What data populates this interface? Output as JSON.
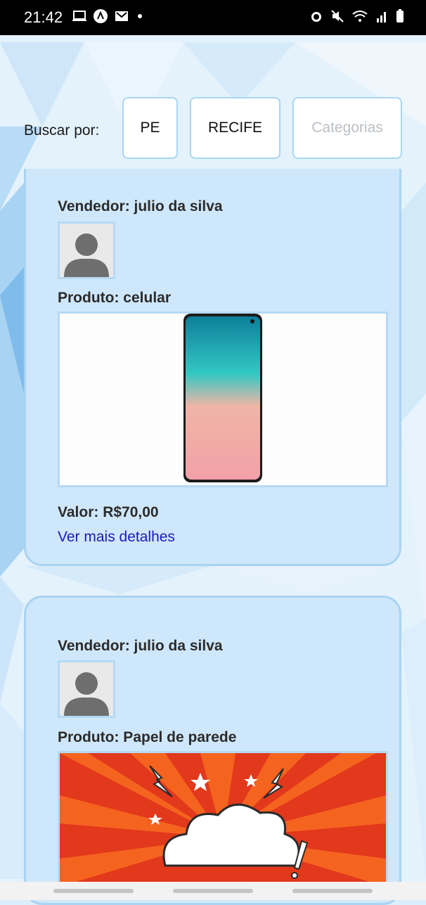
{
  "statusbar": {
    "time": "21:42",
    "left_icons": [
      "laptop-icon",
      "android-icon",
      "gmail-icon",
      "dot-icon"
    ],
    "right_icons": [
      "alarm-icon",
      "mute-icon",
      "wifi-icon",
      "signal-icon",
      "battery-icon"
    ]
  },
  "filter": {
    "label": "Buscar por:",
    "state": "PE",
    "city": "RECIFE",
    "category_placeholder": "Categorias"
  },
  "listings": [
    {
      "seller": "Vendedor: julio da silva",
      "product": "Produto: celular",
      "price": "Valor: R$70,00",
      "details_link": "Ver mais detalhes",
      "image_icon": "smartphone-image"
    },
    {
      "seller": "Vendedor: julio da silva",
      "product": "Produto: Papel de parede",
      "image_icon": "comic-explosion-image"
    }
  ],
  "colors": {
    "card_bg": "#cfe7fa",
    "card_border": "#aad3f2",
    "link": "#1b1bb8"
  }
}
